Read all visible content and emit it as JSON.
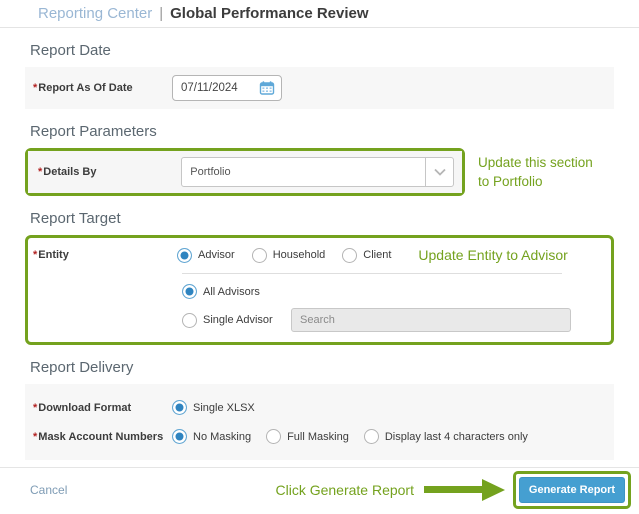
{
  "header": {
    "breadcrumb": "Reporting Center",
    "separator": "|",
    "title": "Global Performance Review"
  },
  "misc": {
    "required_mark": "*"
  },
  "report_date": {
    "heading": "Report Date",
    "field_label": "Report As Of Date",
    "value": "07/11/2024",
    "icon": "calendar-icon"
  },
  "report_parameters": {
    "heading": "Report Parameters",
    "field_label": "Details By",
    "selected_value": "Portfolio",
    "dropdown_icon": "chevron-down-icon",
    "annotation_line1": "Update this section",
    "annotation_line2": "to Portfolio"
  },
  "report_target": {
    "heading": "Report Target",
    "entity_label": "Entity",
    "entity_options": [
      {
        "label": "Advisor",
        "selected": true
      },
      {
        "label": "Household",
        "selected": false
      },
      {
        "label": "Client",
        "selected": false
      }
    ],
    "annotation": "Update Entity to Advisor",
    "scope_options": [
      {
        "label": "All Advisors",
        "selected": true
      },
      {
        "label": "Single Advisor",
        "selected": false
      }
    ],
    "search_placeholder": "Search"
  },
  "report_delivery": {
    "heading": "Report Delivery",
    "download_label": "Download Format",
    "download_options": [
      {
        "label": "Single XLSX",
        "selected": true
      }
    ],
    "mask_label": "Mask Account Numbers",
    "mask_options": [
      {
        "label": "No Masking",
        "selected": true
      },
      {
        "label": "Full Masking",
        "selected": false
      },
      {
        "label": "Display last 4 characters only",
        "selected": false
      }
    ]
  },
  "footer": {
    "cancel_label": "Cancel",
    "annotation": "Click Generate Report",
    "arrow_icon": "arrow-right-annotation",
    "generate_label": "Generate Report"
  },
  "colors": {
    "annotation_green": "#74a21e",
    "button_blue": "#459fd1",
    "radio_blue": "#2f84c0",
    "breadcrumb_blue": "#9ab7d4"
  }
}
